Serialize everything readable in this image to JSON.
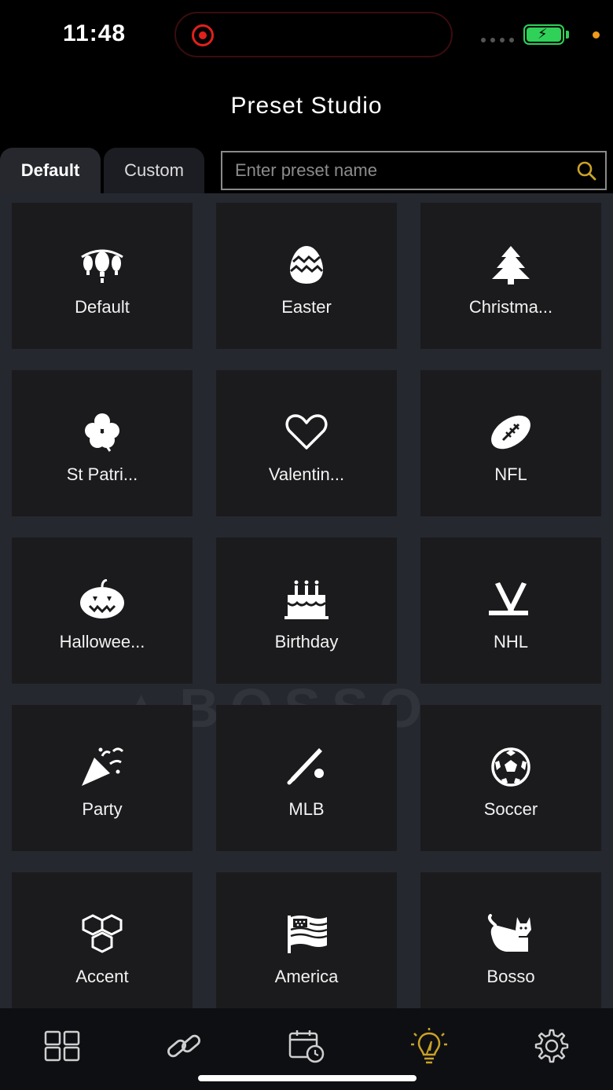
{
  "status_bar": {
    "time": "11:48"
  },
  "header": {
    "title": "Preset Studio"
  },
  "tabs": [
    {
      "label": "Default",
      "active": true
    },
    {
      "label": "Custom",
      "active": false
    }
  ],
  "search": {
    "placeholder": "Enter preset name",
    "value": ""
  },
  "presets": [
    {
      "label": "Default",
      "icon": "lights-icon"
    },
    {
      "label": "Easter",
      "icon": "egg-icon"
    },
    {
      "label": "Christma...",
      "icon": "tree-icon"
    },
    {
      "label": "St Patri...",
      "icon": "clover-icon"
    },
    {
      "label": "Valentin...",
      "icon": "heart-icon"
    },
    {
      "label": "NFL",
      "icon": "football-icon"
    },
    {
      "label": "Halloweе...",
      "icon": "pumpkin-icon"
    },
    {
      "label": "Birthday",
      "icon": "cake-icon"
    },
    {
      "label": "NHL",
      "icon": "hockey-icon"
    },
    {
      "label": "Party",
      "icon": "party-popper-icon"
    },
    {
      "label": "MLB",
      "icon": "baseball-bat-icon"
    },
    {
      "label": "Soccer",
      "icon": "soccer-ball-icon"
    },
    {
      "label": "Accent",
      "icon": "cubes-icon"
    },
    {
      "label": "America",
      "icon": "flag-icon"
    },
    {
      "label": "Bosso",
      "icon": "cat-icon"
    }
  ],
  "bottom_nav": [
    {
      "icon": "grid-icon",
      "active": false
    },
    {
      "icon": "link-icon",
      "active": false
    },
    {
      "icon": "calendar-clock-icon",
      "active": false
    },
    {
      "icon": "lightbulb-icon",
      "active": true
    },
    {
      "icon": "gear-icon",
      "active": false
    }
  ],
  "colors": {
    "accent": "#c9a227",
    "tile": "#1b1b1d",
    "grid_bg": "#262830",
    "battery": "#2fd158",
    "record": "#e0201c"
  }
}
